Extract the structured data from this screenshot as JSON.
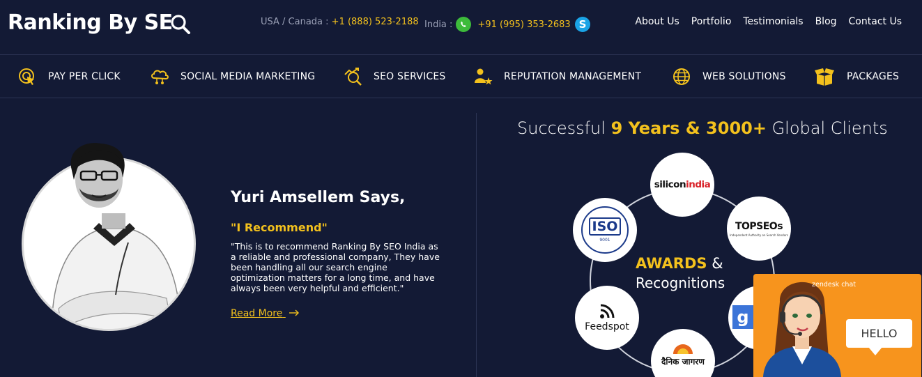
{
  "header": {
    "logo_text": "Ranking By SE",
    "contact_usa_label": "USA / Canada : ",
    "contact_usa_number": "+1 (888) 523-2188",
    "contact_india_label": "India : ",
    "contact_india_number": "+91 (995) 353-2683",
    "nav": [
      "About Us",
      "Portfolio",
      "Testimonials",
      "Blog",
      "Contact Us"
    ]
  },
  "services": [
    {
      "label": "PAY PER CLICK",
      "icon": "target-click-icon"
    },
    {
      "label": "SOCIAL MEDIA MARKETING",
      "icon": "cloud-network-icon"
    },
    {
      "label": "SEO SERVICES",
      "icon": "seo-chart-search-icon"
    },
    {
      "label": "REPUTATION MANAGEMENT",
      "icon": "person-star-icon"
    },
    {
      "label": "WEB SOLUTIONS",
      "icon": "globe-icon"
    },
    {
      "label": "PACKAGES",
      "icon": "open-box-icon"
    }
  ],
  "testimonial": {
    "name_line": "Yuri Amsellem Says,",
    "headline": "\"I Recommend\"",
    "quote": "\"This is to recommend Ranking By SEO India as a reliable and professional company, They have been handling all our search engine optimization matters for a long time, and have always been very helpful and efficient.\"",
    "read_more": "Read More"
  },
  "awards": {
    "title_prefix": "Successful ",
    "title_highlight": "9 Years & 3000+",
    "title_suffix": " Global Clients",
    "center_bold": "AWARDS",
    "center_amp": " &",
    "center_sub": "Recognitions",
    "badges": {
      "silicon_a": "silicon",
      "silicon_b": "india",
      "topseos": "TOPSEOs",
      "topseos_sub": "Independent Authority on Search Vendors",
      "iso": "ISO",
      "iso_num": "9001",
      "feedspot": "Feedspot",
      "dainik": "दैनिक जागरण",
      "google": "g"
    }
  },
  "chat": {
    "brand": "zendesk chat",
    "greeting": "HELLO"
  },
  "colors": {
    "background": "#131a35",
    "accent": "#f3c11d",
    "chat": "#f7941d"
  }
}
